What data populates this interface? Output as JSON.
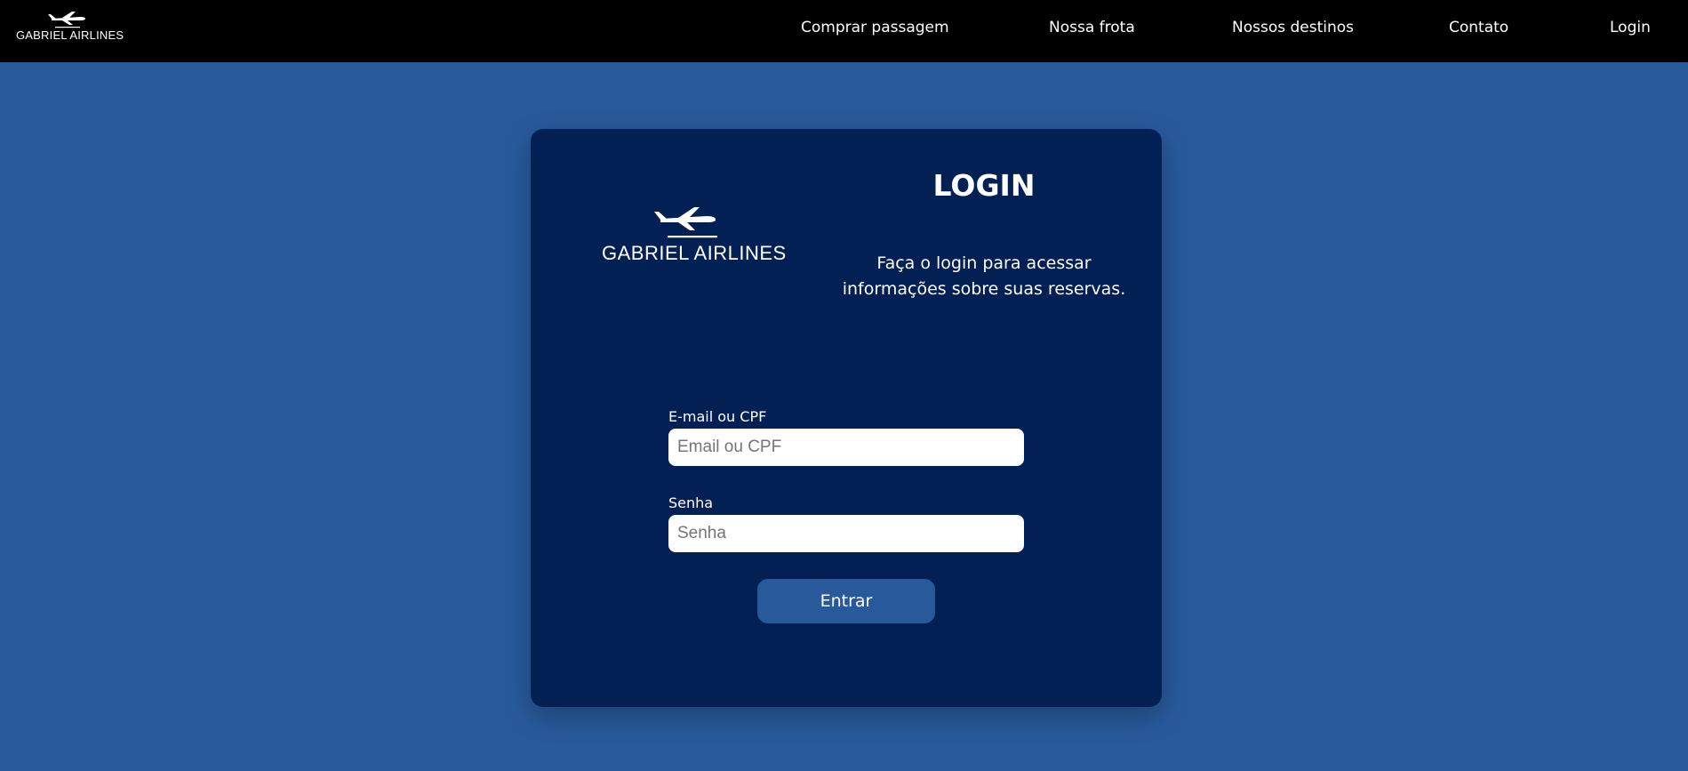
{
  "brand": {
    "name": "GABRIEL AIRLINES",
    "logo_icon": "airplane-icon"
  },
  "nav": {
    "items": [
      {
        "label": "Comprar passagem"
      },
      {
        "label": "Nossa frota"
      },
      {
        "label": "Nossos destinos"
      },
      {
        "label": "Contato"
      },
      {
        "label": "Login"
      }
    ]
  },
  "login": {
    "title": "LOGIN",
    "description": "Faça o login para acessar informações sobre suas reservas.",
    "email": {
      "label": "E-mail ou CPF",
      "placeholder": "Email ou CPF",
      "value": ""
    },
    "password": {
      "label": "Senha",
      "placeholder": "Senha",
      "value": ""
    },
    "submit_label": "Entrar"
  },
  "colors": {
    "page_background": "#285a9b",
    "topbar_background": "#000000",
    "card_background": "#032054",
    "button_background": "#285a9b",
    "text": "#ffffff"
  }
}
